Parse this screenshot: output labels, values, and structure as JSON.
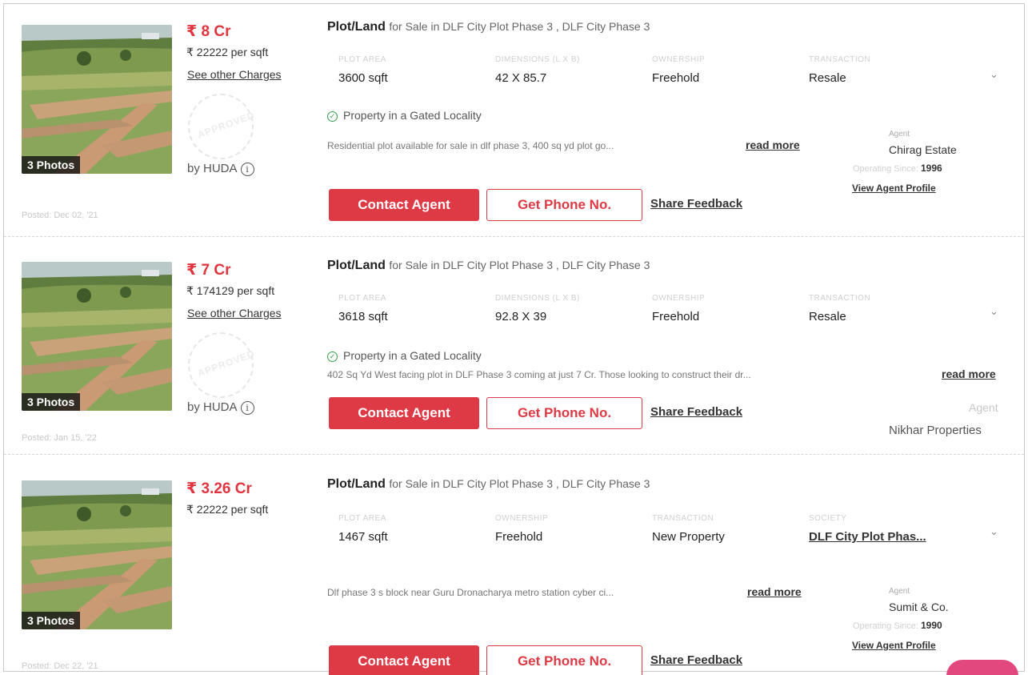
{
  "listings": [
    {
      "photos_label": "3 Photos",
      "posted": "Posted: Dec 02, '21",
      "price": "₹ 8 Cr",
      "per_sqft": "₹ 22222 per sqft",
      "charges_link": "See other Charges",
      "approved_stamp": "APPROVED",
      "approved_by": "by HUDA",
      "title_type": "Plot/Land",
      "title_rest": "for Sale in DLF City Plot Phase 3 , DLF City Phase 3",
      "specs": [
        {
          "label": "PLOT AREA",
          "value": "3600 sqft"
        },
        {
          "label": "DIMENSIONS (L X B)",
          "value": "42 X 85.7"
        },
        {
          "label": "OWNERSHIP",
          "value": "Freehold"
        },
        {
          "label": "TRANSACTION",
          "value": "Resale"
        }
      ],
      "gated": "Property in a Gated Locality",
      "description": "Residential plot available for sale in dlf phase 3, 400 sq yd plot go...",
      "read_more": "read more",
      "agent_label": "Agent",
      "agent_name": "Chirag Estate",
      "operating_since_label": "Operating Since:",
      "operating_since_year": "1996",
      "view_agent_profile": "View Agent Profile",
      "contact_button": "Contact Agent",
      "phone_button": "Get Phone No.",
      "feedback_link": "Share Feedback"
    },
    {
      "photos_label": "3 Photos",
      "posted": "Posted: Jan 15, '22",
      "price": "₹ 7 Cr",
      "per_sqft": "₹ 174129 per sqft",
      "charges_link": "See other Charges",
      "approved_stamp": "APPROVED",
      "approved_by": "by HUDA",
      "title_type": "Plot/Land",
      "title_rest": "for Sale in DLF City Plot Phase 3 , DLF City Phase 3",
      "specs": [
        {
          "label": "PLOT AREA",
          "value": "3618 sqft"
        },
        {
          "label": "DIMENSIONS (L X B)",
          "value": "92.8 X 39"
        },
        {
          "label": "OWNERSHIP",
          "value": "Freehold"
        },
        {
          "label": "TRANSACTION",
          "value": "Resale"
        }
      ],
      "gated": "Property in a Gated Locality",
      "description": "402 Sq Yd West facing plot in DLF Phase 3 coming at just 7 Cr. Those looking to construct their dr...",
      "read_more": "read more",
      "agent_label": "Agent",
      "agent_name": "Nikhar Properties",
      "contact_button": "Contact Agent",
      "phone_button": "Get Phone No.",
      "feedback_link": "Share Feedback"
    },
    {
      "photos_label": "3 Photos",
      "posted": "Posted: Dec 22, '21",
      "price": "₹ 3.26 Cr",
      "per_sqft": "₹ 22222 per sqft",
      "title_type": "Plot/Land",
      "title_rest": "for Sale in DLF City Plot Phase 3 , DLF City Phase 3",
      "specs": [
        {
          "label": "PLOT AREA",
          "value": "1467 sqft"
        },
        {
          "label": "OWNERSHIP",
          "value": "Freehold"
        },
        {
          "label": "TRANSACTION",
          "value": "New Property"
        },
        {
          "label": "SOCIETY",
          "value": "DLF City Plot Phas..."
        }
      ],
      "description": "Dlf phase 3 s block near Guru Dronacharya metro station cyber ci...",
      "read_more": "read more",
      "agent_label": "Agent",
      "agent_name": "Sumit & Co.",
      "operating_since_label": "Operating Since:",
      "operating_since_year": "1990",
      "view_agent_profile": "View Agent Profile",
      "contact_button": "Contact Agent",
      "phone_button": "Get Phone No.",
      "feedback_link": "Share Feedback"
    }
  ],
  "icons": {
    "info": "info-icon",
    "check": "check-circle-icon",
    "chevron": "chevron-down-icon"
  },
  "colors": {
    "accent": "#dd3a45",
    "price": "#e0343f",
    "gated_check": "#37a14b"
  }
}
